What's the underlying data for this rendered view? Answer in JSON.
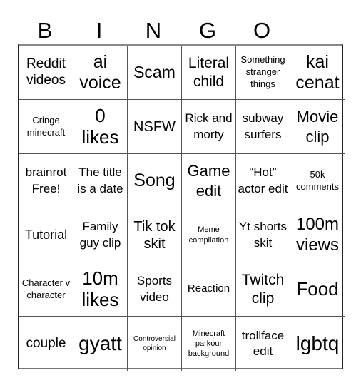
{
  "header": {
    "letters": [
      "B",
      "I",
      "N",
      "G",
      "O"
    ]
  },
  "grid": {
    "columns": 6,
    "rows": 6,
    "cells": [
      "Reddit videos",
      "ai voice",
      "Scam",
      "Literal child",
      "Something stranger things",
      "kai cenat",
      "Cringe minecraft",
      "0 likes",
      "NSFW",
      "Rick and morty",
      "subway surfers",
      "Movie clip",
      "brainrot Free!",
      "The title is a date",
      "Song",
      "Game edit",
      "“Hot” actor edit",
      "50k comments",
      "Tutorial",
      "Family guy clip",
      "Tik tok skit",
      "Meme compilation",
      "Yt shorts skit",
      "100m views",
      "Character v character",
      "10m likes",
      "Sports video",
      "Reaction",
      "Twitch clip",
      "Food",
      "couple",
      "gyatt",
      "Controversial opinion",
      "Minecraft parkour background",
      "trollface edit",
      "lgbtq"
    ]
  },
  "colors": {
    "background": "#ffffff",
    "text": "#000000",
    "grid_line": "#555555"
  }
}
